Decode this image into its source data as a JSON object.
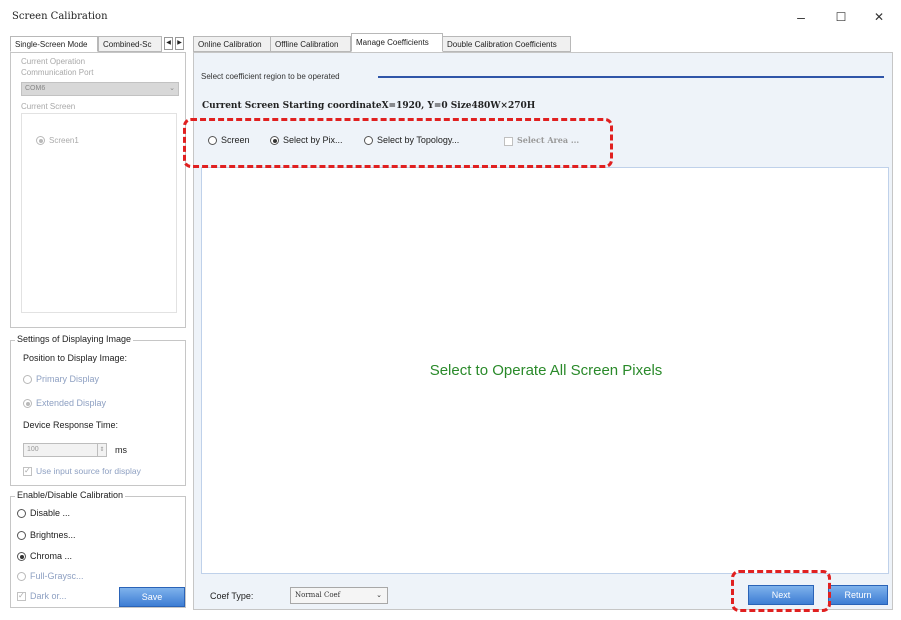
{
  "window": {
    "title": "Screen Calibration",
    "minimize": "–",
    "maximize": "☐",
    "close": "✕"
  },
  "left_tabs": {
    "single": "Single-Screen Mode",
    "combined": "Combined-Sc",
    "prev": "◀",
    "next": "▶"
  },
  "left_panel": {
    "current_operation": "Current Operation",
    "comm_port": "Communication Port",
    "port_value": "COM6",
    "current_screen": "Current Screen",
    "screen_item": "Screen1"
  },
  "settings": {
    "title": "Settings of Displaying Image",
    "position_label": "Position to Display Image:",
    "primary": "Primary Display",
    "extended": "Extended Display",
    "response_label": "Device Response Time:",
    "response_value": "100",
    "response_unit": "ms",
    "use_input": "Use input source for display"
  },
  "enable": {
    "title": "Enable/Disable Calibration",
    "disable": "Disable ...",
    "brightness": "Brightnes...",
    "chroma": "Chroma ...",
    "fullgray": "Full-Graysc...",
    "dark": "Dark or...",
    "save": "Save"
  },
  "right_tabs": {
    "online": "Online Calibration",
    "offline": "Offline Calibration",
    "manage": "Manage Coefficients",
    "double": "Double Calibration Coefficients"
  },
  "manage": {
    "region_label": "Select coefficient region to be operated",
    "current_screen": "Current Screen   Starting coordinateX=1920, Y=0    Size480W×270H",
    "opt_screen": "Screen",
    "opt_pixel": "Select by Pix...",
    "opt_topology": "Select by Topology...",
    "select_area": "Select Area ...",
    "ops_text": "Select to Operate All Screen Pixels",
    "coef_label": "Coef Type:",
    "coef_value": "Normal Coef",
    "next": "Next",
    "return": "Return"
  }
}
